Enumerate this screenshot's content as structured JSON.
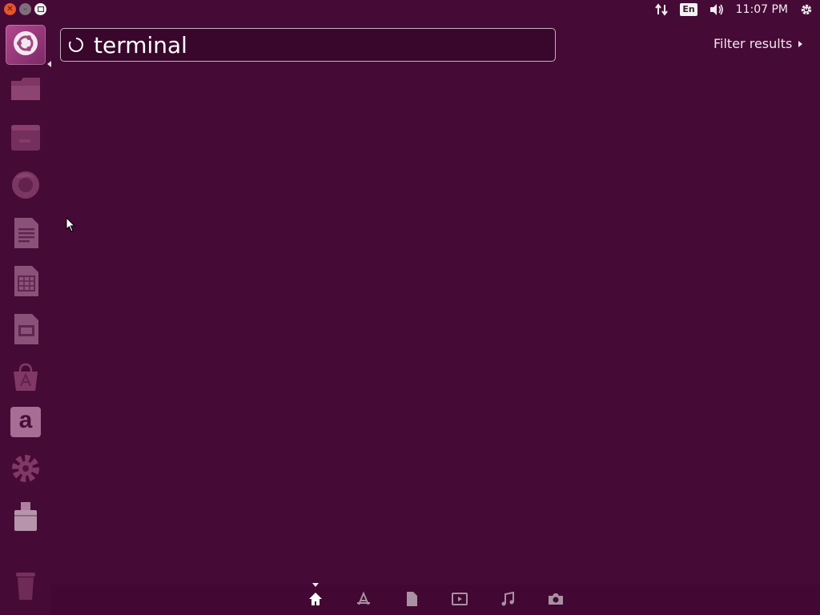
{
  "window_controls": {
    "close_icon": "close-icon",
    "minimize_icon": "minimize-icon",
    "maximize_icon": "maximize-icon"
  },
  "top_panel": {
    "network_icon": "network-updown-icon",
    "keyboard_layout": "En",
    "volume_icon": "volume-icon",
    "clock": "11:07 PM",
    "session_icon": "gear-power-icon"
  },
  "launcher": {
    "items": [
      {
        "name": "dash-home",
        "icon": "ubuntu-logo-icon"
      },
      {
        "name": "home-folder",
        "icon": "folder-icon"
      },
      {
        "name": "browser-window",
        "icon": "window-icon"
      },
      {
        "name": "firefox",
        "icon": "firefox-icon"
      },
      {
        "name": "libreoffice-writer",
        "icon": "writer-icon"
      },
      {
        "name": "libreoffice-calc",
        "icon": "calc-icon"
      },
      {
        "name": "libreoffice-impress",
        "icon": "impress-icon"
      },
      {
        "name": "software-center",
        "icon": "software-center-icon"
      },
      {
        "name": "amazon",
        "icon": "amazon-icon"
      },
      {
        "name": "system-settings",
        "icon": "settings-gear-icon"
      },
      {
        "name": "usb-drive",
        "icon": "usb-drive-icon"
      },
      {
        "name": "trash",
        "icon": "trash-icon"
      }
    ],
    "amazon_letter": "a"
  },
  "search": {
    "value": "terminal",
    "placeholder": "",
    "spinner_icon": "spinner-icon"
  },
  "filter": {
    "label": "Filter results"
  },
  "lenses": [
    {
      "name": "home",
      "icon": "home-icon",
      "active": true
    },
    {
      "name": "applications",
      "icon": "applications-icon",
      "active": false
    },
    {
      "name": "files",
      "icon": "file-icon",
      "active": false
    },
    {
      "name": "video",
      "icon": "video-icon",
      "active": false
    },
    {
      "name": "music",
      "icon": "music-icon",
      "active": false
    },
    {
      "name": "photos",
      "icon": "camera-icon",
      "active": false
    }
  ],
  "colors": {
    "background": "#460a37",
    "accent": "#b2478e",
    "close_button": "#e6552a"
  }
}
